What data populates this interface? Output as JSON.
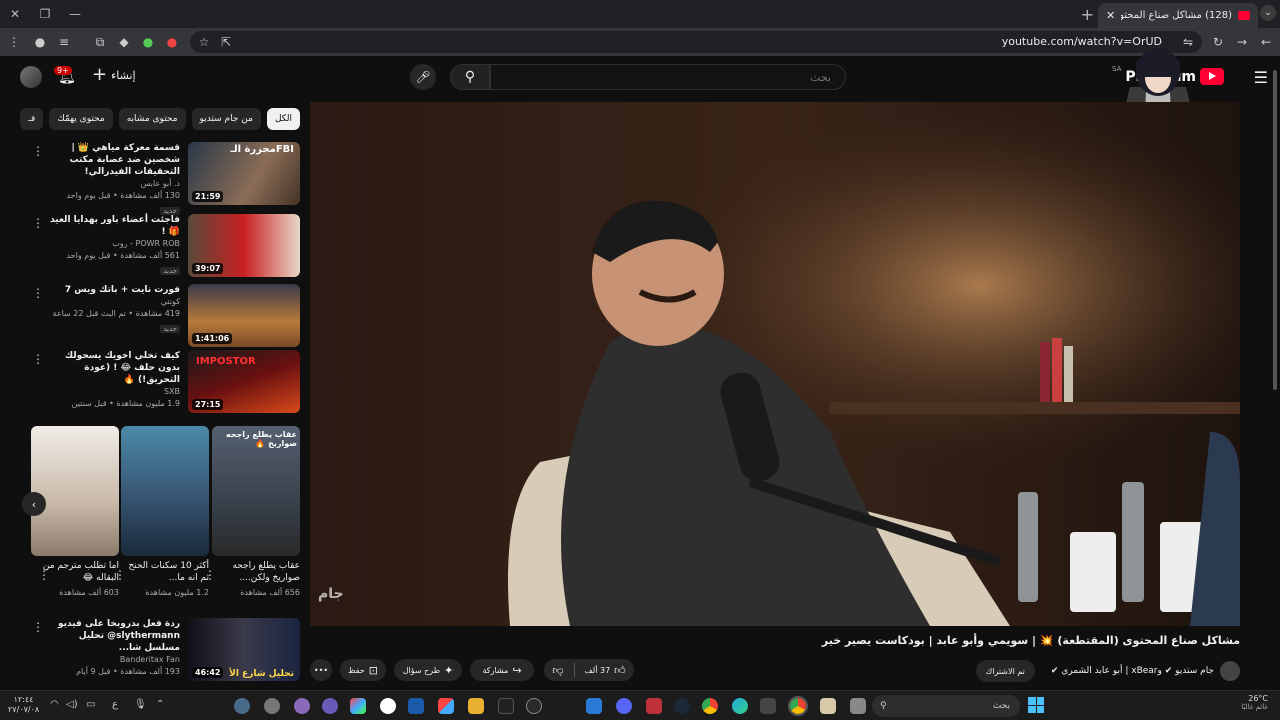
{
  "browser": {
    "tab_title": "(128) مشاكل صناع المحتوى (",
    "url": "youtube.com/watch?v=OrUD",
    "win_min": "—",
    "win_max": "❐",
    "win_close": "✕"
  },
  "header": {
    "search_placeholder": "بحث",
    "create_label": "إنشاء",
    "bell_badge": "9+",
    "logo_word": "Premium",
    "logo_region": "SA"
  },
  "chips": [
    "الكل",
    "من جام ستديو",
    "محتوى مشابه",
    "محتوى يهمّك",
    "فـ"
  ],
  "recommendations": [
    {
      "title": "قسمة معركة مياهي 👑 | شخصين ضد عصابة مكتب التحقيقات الفيدرالي!",
      "channel": "د. أبو عابس",
      "stats": "130 ألف مشاهدة • قبل يوم واحد",
      "badge": "جديد",
      "duration": "21:59",
      "thumb_caption": "مجزرة الـFBI"
    },
    {
      "title": "فاجئت أعضاء باور بهدايا العيد 🎁 !",
      "channel": "POWR ROB - روب",
      "stats": "561 ألف مشاهدة • قبل يوم واحد",
      "badge": "جديد",
      "duration": "39:07",
      "thumb_caption": ""
    },
    {
      "title": "فورت نايت + باتك ويس 7",
      "channel": "كونتي",
      "stats": "419 مشاهدة • تم البث قبل 22 ساعة",
      "badge": "جديد",
      "duration": "1:41:06",
      "thumb_caption": ""
    },
    {
      "title": "كيف تخلي اخويك يسحولك بدون حلف 😂 ! (عودة التحريق!) 🔥",
      "channel": "SXB",
      "stats": "1.9 مليون مشاهدة • قبل سنتين",
      "badge": "",
      "duration": "27:15",
      "thumb_caption": "IMPOSTOR"
    },
    {
      "title": "ردة فعل بدروبخا على فيديو slythermann@ تحليل مسلسل شا...",
      "channel": "Banderitax Fan",
      "stats": "193 ألف مشاهدة • قبل 9 أيام",
      "badge": "",
      "duration": "46:42",
      "thumb_caption": "تحليل شارع الأ"
    }
  ],
  "shorts": [
    {
      "title": "عقاب يطلع راجحه صواريخ ولكن....",
      "views": "656 ألف مشاهدة",
      "caption": "عقاب يطلع راجحه صواريخ 🔥"
    },
    {
      "title": "أكثر 10 سكنات الحنح ثم انه ما...",
      "views": "1.2 مليون مشاهدة",
      "caption": ""
    },
    {
      "title": "اما تطلب مترجم من البقاله 😂",
      "views": "603 ألف مشاهدة",
      "caption": ""
    }
  ],
  "video": {
    "title": "مشاكل صناع المحتوى (المقتطعة) 💥 | سويمي وأبو عابد | بودكاست يصير خير",
    "channels": "جام ستديو ✔ وxBear | أبو عابد الشمري ✔",
    "subscribed": "تم الاشتراك",
    "likes": "37 ألف",
    "share": "مشاركة",
    "ask": "طرح سؤال",
    "save": "حفظ",
    "watermark": "جام"
  },
  "taskbar": {
    "search": "بحث",
    "temp": "26°C",
    "weather": "غائم غالبًا",
    "time": "١٢:٤٤",
    "date": "٢٧/٠٧/٠٨"
  },
  "colors": {
    "accent": "#ff0033",
    "bg": "#0f0f0f"
  }
}
